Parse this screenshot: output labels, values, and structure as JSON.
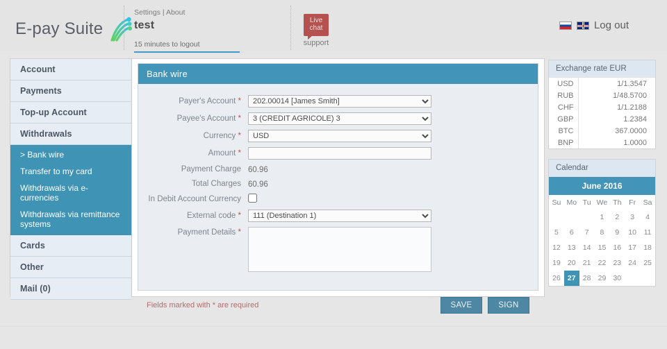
{
  "header": {
    "brand": "E-pay Suite",
    "logo_icon": "swoosh-logo-icon",
    "settings_link": "Settings",
    "links_divider": "|",
    "about_link": "About",
    "username": "test",
    "timer": "15 minutes to logout",
    "livechat_line1": "Live",
    "livechat_line2": "chat",
    "livechat_support": "support",
    "flag_ru": "flag-russia-icon",
    "flag_gb": "flag-uk-icon",
    "logout_label": "Log out"
  },
  "sidebar": {
    "items": [
      {
        "label": "Account"
      },
      {
        "label": "Payments"
      },
      {
        "label": "Top-up Account"
      },
      {
        "label": "Withdrawals"
      }
    ],
    "submenu": [
      {
        "label": "> Bank wire",
        "active": true
      },
      {
        "label": "Transfer to my card",
        "active": false
      },
      {
        "label": "Withdrawals via e-currencies",
        "active": false
      },
      {
        "label": "Withdrawals via remittance systems",
        "active": false
      }
    ],
    "items_after": [
      {
        "label": "Cards"
      },
      {
        "label": "Other"
      },
      {
        "label": "Mail (0)"
      }
    ]
  },
  "form": {
    "title": "Bank wire",
    "fields": {
      "payers_account": {
        "label": "Payer's Account",
        "required": "*",
        "value": "202.00014 [James Smith]"
      },
      "payees_account": {
        "label": "Payee's Account",
        "required": "*",
        "value": "3 (CREDIT AGRICOLE) 3"
      },
      "currency": {
        "label": "Currency",
        "required": "*",
        "value": "USD"
      },
      "amount": {
        "label": "Amount",
        "required": "*",
        "value": "",
        "placeholder": ""
      },
      "payment_charge": {
        "label": "Payment Charge",
        "value": "60.96"
      },
      "total_charges": {
        "label": "Total Charges",
        "value": "60.96"
      },
      "in_debit_account_currency": {
        "label": "In Debit Account Currency",
        "checked": false
      },
      "external_code": {
        "label": "External code",
        "required": "*",
        "value": "111 (Destination 1)"
      },
      "payment_details": {
        "label": "Payment Details",
        "required": "*",
        "value": "",
        "placeholder": ""
      }
    },
    "required_note": "Fields marked with * are required",
    "save_label": "SAVE",
    "sign_label": "SIGN"
  },
  "exchange": {
    "title": "Exchange rate EUR",
    "rows": [
      {
        "currency": "USD",
        "rate": "1/1.3547"
      },
      {
        "currency": "RUB",
        "rate": "1/48.5700"
      },
      {
        "currency": "CHF",
        "rate": "1/1.2188"
      },
      {
        "currency": "GBP",
        "rate": "1.2384"
      },
      {
        "currency": "BTC",
        "rate": "367.0000"
      },
      {
        "currency": "BNP",
        "rate": "1.0000"
      }
    ]
  },
  "calendar": {
    "title": "Calendar",
    "month": "June 2016",
    "weekdays": [
      "Su",
      "Mo",
      "Tu",
      "We",
      "Th",
      "Fr",
      "Sa"
    ],
    "weeks": [
      [
        "",
        "",
        "",
        "1",
        "2",
        "3",
        "4"
      ],
      [
        "5",
        "6",
        "7",
        "8",
        "9",
        "10",
        "11"
      ],
      [
        "12",
        "13",
        "14",
        "15",
        "16",
        "17",
        "18"
      ],
      [
        "19",
        "20",
        "21",
        "22",
        "23",
        "24",
        "25"
      ],
      [
        "26",
        "27",
        "28",
        "29",
        "30",
        "",
        ""
      ]
    ],
    "today": "27"
  },
  "colors": {
    "accent_teal": "#4295b8",
    "submenu_teal": "#3f93b5",
    "sidebar_blue": "#dfe8f2",
    "button_blue": "#4d87a3",
    "required_red": "#c0514e",
    "livechat_red": "#b5514e"
  }
}
